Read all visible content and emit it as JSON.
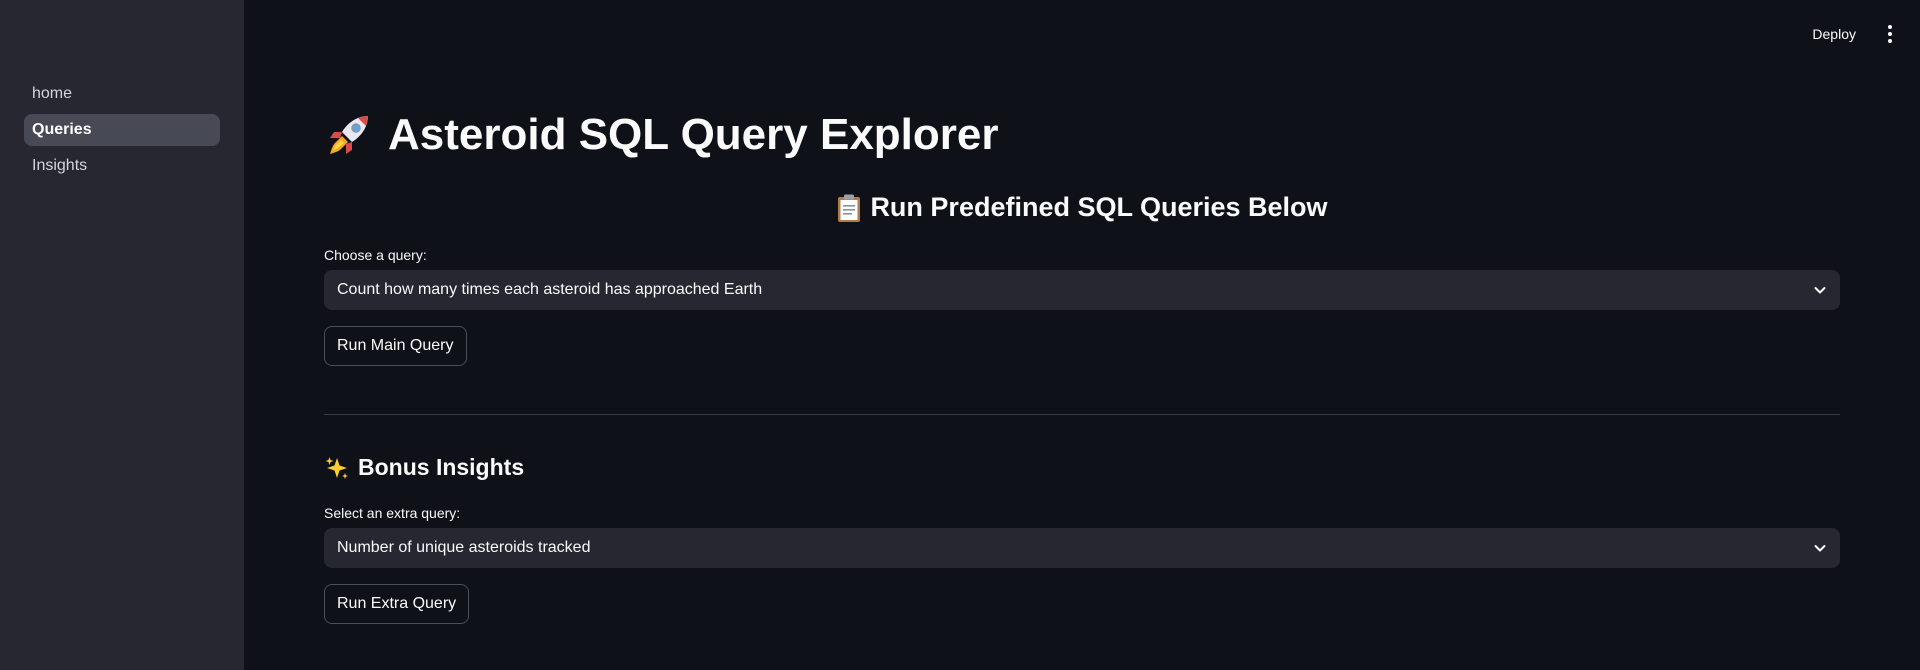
{
  "sidebar": {
    "items": [
      {
        "label": "home",
        "active": false
      },
      {
        "label": "Queries",
        "active": true
      },
      {
        "label": "Insights",
        "active": false
      }
    ]
  },
  "header": {
    "deploy_label": "Deploy",
    "menu_icon": "kebab-menu-icon"
  },
  "main": {
    "title": "Asteroid SQL Query Explorer",
    "title_icon": "rocket-icon",
    "subtitle": "Run Predefined SQL Queries Below",
    "subtitle_icon": "clipboard-icon",
    "query_select": {
      "label": "Choose a query:",
      "value": "Count how many times each asteroid has approached Earth"
    },
    "run_main_label": "Run Main Query",
    "bonus": {
      "heading": "Bonus Insights",
      "icon": "sparkles-icon",
      "select_label": "Select an extra query:",
      "select_value": "Number of unique asteroids tracked",
      "run_extra_label": "Run Extra Query"
    }
  },
  "colors": {
    "background": "#0e1117",
    "sidebar": "#262730",
    "active_nav": "#474955",
    "select_bg": "#262730",
    "text": "#fafafa"
  }
}
